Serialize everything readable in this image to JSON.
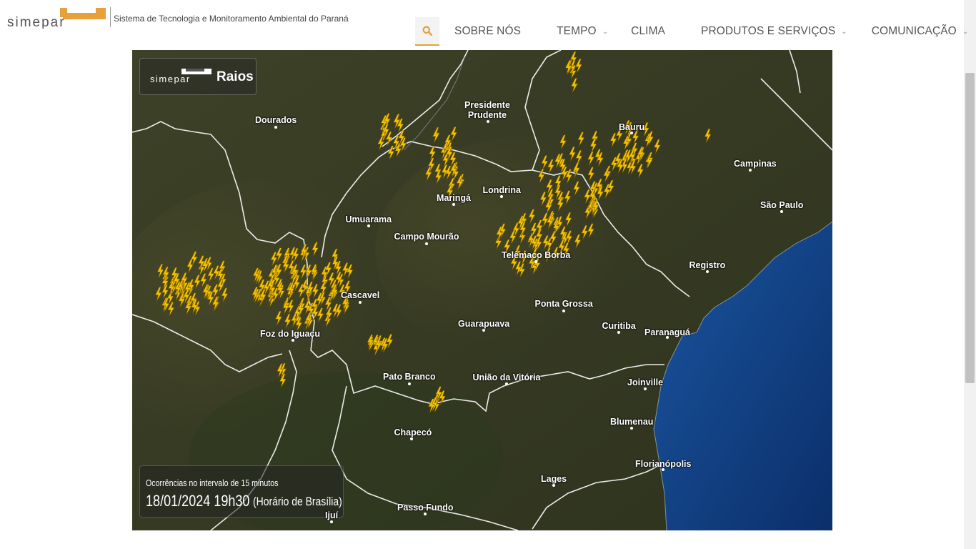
{
  "header": {
    "tagline": "Sistema de Tecnologia e Monitoramento Ambiental do Paraná",
    "logo_alt": "simepar",
    "nav": [
      {
        "label": "SOBRE NÓS",
        "has_submenu": false
      },
      {
        "label": "TEMPO",
        "has_submenu": true
      },
      {
        "label": "CLIMA",
        "has_submenu": false
      },
      {
        "label": "PRODUTOS E SERVIÇOS",
        "has_submenu": true
      },
      {
        "label": "COMUNICAÇÃO",
        "has_submenu": true
      }
    ],
    "accent": "#e8a13a"
  },
  "map": {
    "badge_brand": "simepar",
    "badge_title": "Raios",
    "caption_line1": "Ocorrências no intervalo de 15 minutos",
    "caption_datetime": "18/01/2024 19h30",
    "caption_timezone": "(Horário de Brasília)",
    "cities": [
      {
        "name": "Dourados"
      },
      {
        "name": "Presidente\nPrudente"
      },
      {
        "name": "Bauru"
      },
      {
        "name": "Campinas"
      },
      {
        "name": "São Paulo"
      },
      {
        "name": "Londrina"
      },
      {
        "name": "Maringá"
      },
      {
        "name": "Umuarama"
      },
      {
        "name": "Campo Mourão"
      },
      {
        "name": "Telêmaco Borba"
      },
      {
        "name": "Registro"
      },
      {
        "name": "Cascavel"
      },
      {
        "name": "Ponta Grossa"
      },
      {
        "name": "Guarapuava"
      },
      {
        "name": "Curitiba"
      },
      {
        "name": "Paranaguá"
      },
      {
        "name": "Foz do Iguaçu"
      },
      {
        "name": "Pato Branco"
      },
      {
        "name": "União da Vitória"
      },
      {
        "name": "Joinville"
      },
      {
        "name": "Chapecó"
      },
      {
        "name": "Blumenau"
      },
      {
        "name": "Florianópolis"
      },
      {
        "name": "Lages"
      },
      {
        "name": "Passo Fundo"
      },
      {
        "name": "Ijuí"
      }
    ],
    "lightning_color": "#f2c200",
    "ocean_color": "#0d3a7a",
    "land_color": "#3a3d24"
  }
}
